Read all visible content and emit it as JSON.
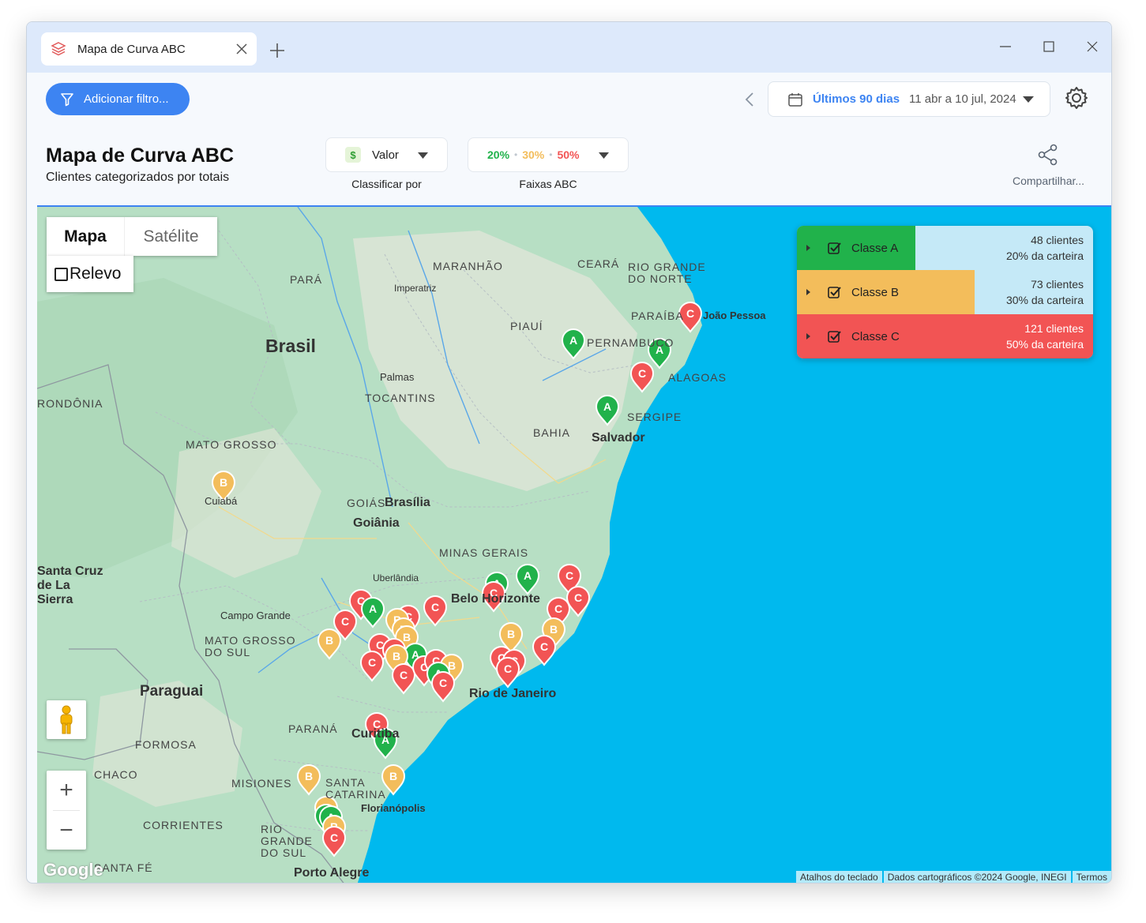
{
  "window": {
    "tab_title": "Mapa de Curva ABC"
  },
  "toolbar": {
    "filter_label": "Adicionar filtro...",
    "date_preset": "Últimos 90 dias",
    "date_range": "11 abr a 10 jul, 2024"
  },
  "header": {
    "title": "Mapa de Curva ABC",
    "subtitle": "Clientes categorizados por totais",
    "sort_value": "Valor",
    "sort_label": "Classificar por",
    "bands": [
      "20%",
      "30%",
      "50%"
    ],
    "bands_label": "Faixas ABC",
    "share_label": "Compartilhar..."
  },
  "map": {
    "type_map": "Mapa",
    "type_satellite": "Satélite",
    "terrain": "Relevo",
    "zoom_in": "+",
    "zoom_out": "−",
    "attribution": [
      "Atalhos do teclado",
      "Dados cartográficos ©2024 Google, INEGI",
      "Termos"
    ],
    "labels": {
      "country_brasil": "Brasil",
      "country_paraguai": "Paraguai",
      "city_salvador": "Salvador",
      "city_brasilia": "Brasília",
      "city_goiania": "Goiânia",
      "city_bh": "Belo Horizonte",
      "city_rio": "Rio de Janeiro",
      "city_curitiba": "Curitiba",
      "city_florianopolis": "Florianópolis",
      "city_porto_alegre": "Porto Alegre",
      "city_campo_grande": "Campo Grande",
      "city_cuiaba": "Cuiabá",
      "city_palmas": "Palmas",
      "city_imperatriz": "Imperatriz",
      "city_uberlandia": "Uberlândia",
      "city_joao_pessoa": "João Pessoa",
      "city_santa_cruz": "Santa Cruz de La Sierra",
      "state_para": "PARÁ",
      "state_maranhao": "MARANHÃO",
      "state_ceara": "CEARÁ",
      "state_rn": "RIO GRANDE DO NORTE",
      "state_paraiba": "PARAÍBA",
      "state_pernambuco": "PERNAMBUCO",
      "state_alagoas": "ALAGOAS",
      "state_sergipe": "SERGIPE",
      "state_bahia": "BAHIA",
      "state_piaui": "PIAUÍ",
      "state_tocantins": "TOCANTINS",
      "state_mt": "MATO GROSSO",
      "state_ms": "MATO GROSSO DO SUL",
      "state_goias": "GOIÁS",
      "state_mg": "MINAS GERAIS",
      "state_parana": "PARANÁ",
      "state_sc": "SANTA CATARINA",
      "state_rs": "RIO GRANDE DO SUL",
      "state_rondonia": "RONDÔNIA",
      "region_formosa": "FORMOSA",
      "region_chaco": "CHACO",
      "region_misiones": "MISIONES",
      "region_corrientes": "CORRIENTES",
      "region_santa_fe": "SANTA FÉ"
    }
  },
  "legend": {
    "classes": [
      {
        "name": "Classe A",
        "clients": "48 clientes",
        "share": "20% da carteira",
        "color": "#21b24b",
        "fraction": 0.4
      },
      {
        "name": "Classe B",
        "clients": "73 clientes",
        "share": "30% da carteira",
        "color": "#f3bd5b",
        "fraction": 0.6
      },
      {
        "name": "Classe C",
        "clients": "121 clientes",
        "share": "50% da carteira",
        "color": "#f25454",
        "fraction": 1.0
      }
    ]
  },
  "colors": {
    "accent": "#3d84f2",
    "class_a": "#21b24b",
    "class_b": "#f3bd5b",
    "class_c": "#f25454",
    "ocean": "#00b9ee"
  }
}
